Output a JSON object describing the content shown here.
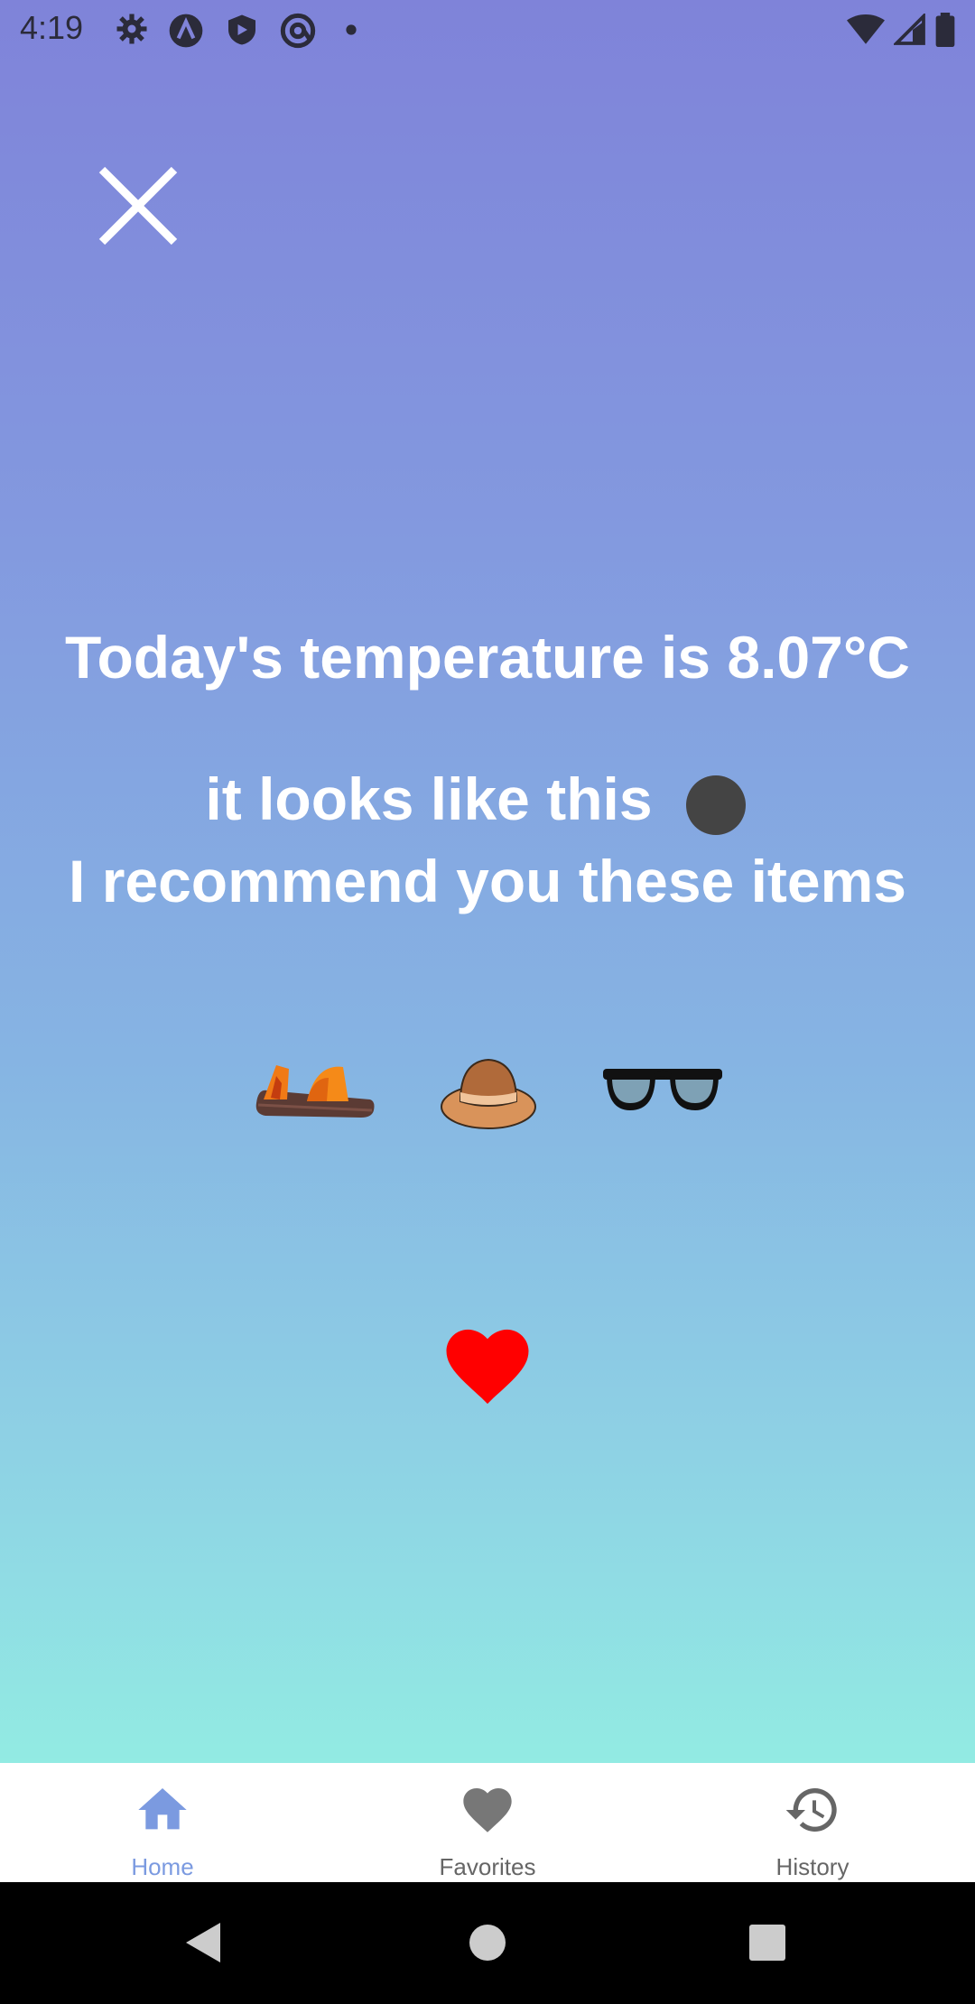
{
  "status_bar": {
    "time": "4:19",
    "icons_left": [
      "gear-icon",
      "a-circle-icon",
      "shield-play-icon",
      "at-circle-icon",
      "dot-icon"
    ],
    "icons_right": [
      "wifi-icon",
      "signal-icon",
      "battery-icon"
    ]
  },
  "main": {
    "temperature_text": "Today's temperature is 8.07°C",
    "looks_text": "it looks like this",
    "recommend_text": "I recommend you these items",
    "weather_icon": "dark-circle-icon",
    "items": [
      "sandal-icon",
      "hat-icon",
      "sunglasses-icon"
    ],
    "favorite_icon": "heart-icon"
  },
  "bottom_nav": {
    "items": [
      {
        "label": "Home",
        "icon": "home-icon",
        "active": true
      },
      {
        "label": "Favorites",
        "icon": "heart-icon",
        "active": false
      },
      {
        "label": "History",
        "icon": "history-icon",
        "active": false
      }
    ]
  },
  "colors": {
    "gradient_top": "#7f83d9",
    "gradient_bottom": "#92ebe3",
    "active_nav": "#7b9ae0",
    "inactive_nav": "#666666",
    "heart": "#ff0000"
  }
}
